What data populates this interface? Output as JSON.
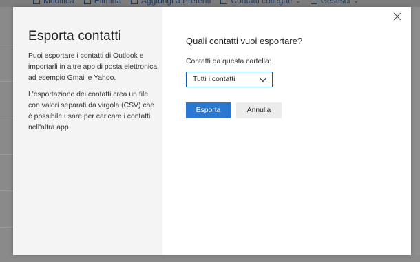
{
  "background_toolbar": {
    "items": [
      {
        "icon": "edit-icon",
        "label": "Modifica"
      },
      {
        "icon": "trash-icon",
        "label": "Elimina"
      },
      {
        "icon": "star-add-icon",
        "label": "Aggiungi a Preferiti"
      },
      {
        "icon": "link-icon",
        "label": "Contatti collegati",
        "has_dropdown": true
      },
      {
        "icon": "manage-icon",
        "label": "Gestisci",
        "has_dropdown": true
      }
    ]
  },
  "dialog": {
    "title": "Esporta contatti",
    "description_1": "Puoi esportare i contatti di Outlook e importarli in altre app di posta elettronica, ad esempio Gmail e Yahoo.",
    "description_2": "L'esportazione dei contatti crea un file con valori separati da virgola (CSV) che è possibile usare per caricare i contatti nell'altra app.",
    "question": "Quali contatti vuoi esportare?",
    "folder_label": "Contatti da questa cartella:",
    "folder_select": {
      "selected": "Tutti i contatti"
    },
    "export_button": "Esporta",
    "cancel_button": "Annulla",
    "close_icon": "close-icon"
  },
  "colors": {
    "accent": "#2a78d2",
    "left_pane": "#f4f4f4",
    "select_border": "#0b5bb5"
  }
}
